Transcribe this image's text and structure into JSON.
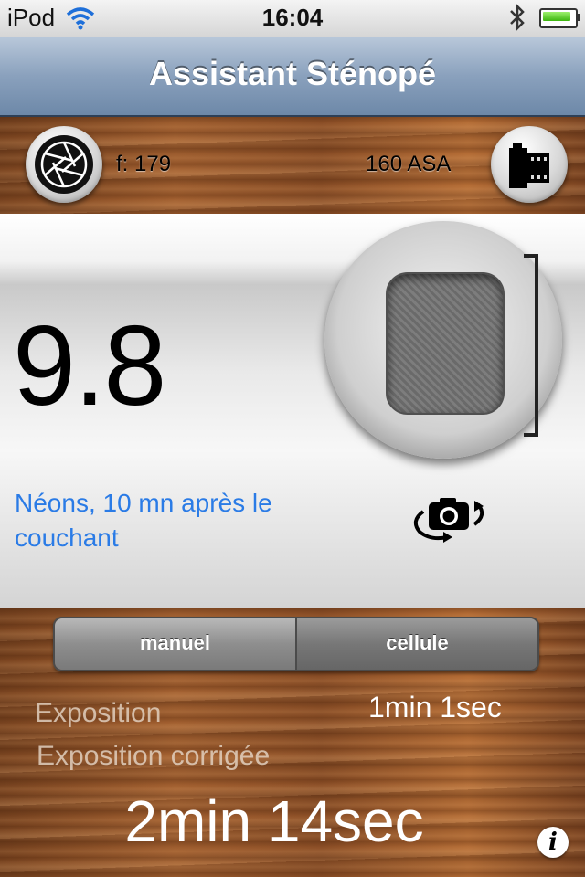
{
  "status_bar": {
    "carrier": "iPod",
    "time": "16:04",
    "icons": [
      "wifi-icon",
      "bluetooth-icon",
      "battery-icon"
    ]
  },
  "nav": {
    "title": "Assistant Sténopé"
  },
  "camera": {
    "aperture_label": "f: 179",
    "film_label": "160 ASA",
    "aperture_icon": "aperture-icon",
    "film_icon": "film-cartridge-icon"
  },
  "meter": {
    "ev": "9.8",
    "scene": "Néons, 10 mn après le couchant",
    "rotate_icon": "rotate-camera-icon"
  },
  "mode": {
    "options": [
      "manuel",
      "cellule"
    ],
    "selected": "cellule"
  },
  "exposure": {
    "label": "Exposition",
    "value": "1min 1sec",
    "corrected_label": "Exposition corrigée",
    "corrected_value": "2min 14sec"
  },
  "info": {
    "glyph": "i",
    "icon": "info-icon"
  },
  "colors": {
    "scene_text": "#2a7be6",
    "nav_bar": "#8aa1bd"
  }
}
